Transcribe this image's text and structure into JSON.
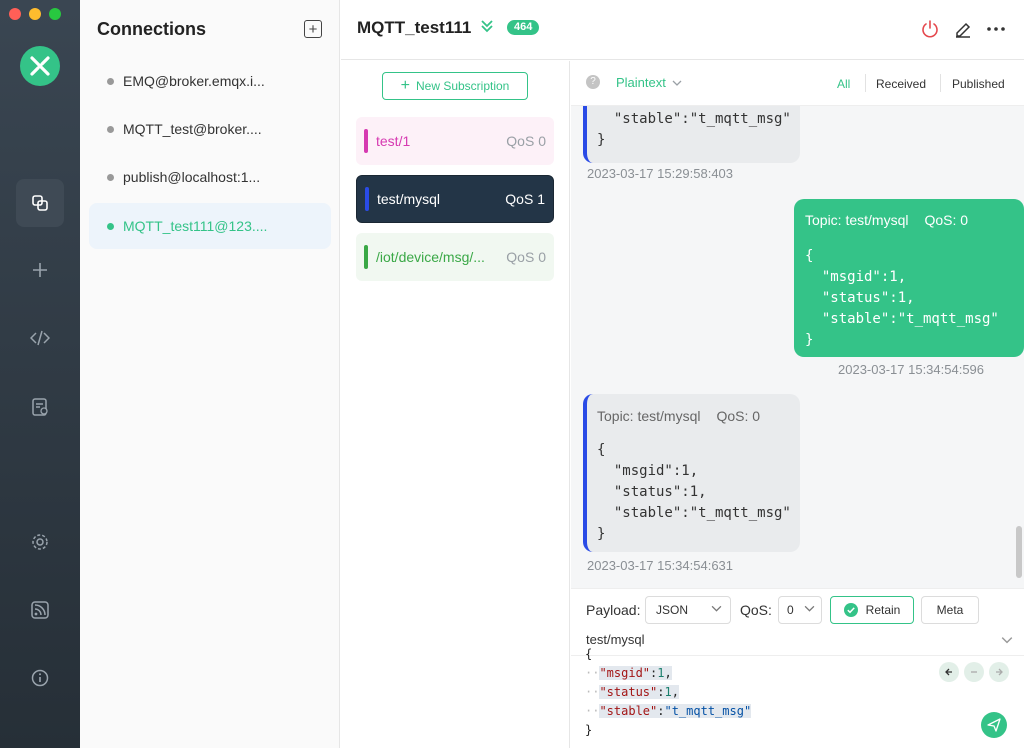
{
  "window": {
    "traffic_colors": [
      "#ff5f57",
      "#febc2e",
      "#28c840"
    ]
  },
  "rail": {
    "items": [
      {
        "name": "connections-icon",
        "active": true
      },
      {
        "name": "plus-icon"
      },
      {
        "name": "code-icon"
      },
      {
        "name": "log-icon"
      },
      {
        "name": "settings-icon"
      },
      {
        "name": "rss-icon"
      },
      {
        "name": "info-icon"
      }
    ]
  },
  "connections": {
    "title": "Connections",
    "items": [
      {
        "label": "EMQ@broker.emqx.i..."
      },
      {
        "label": "MQTT_test@broker...."
      },
      {
        "label": "publish@localhost:1..."
      },
      {
        "label": "MQTT_test111@123....",
        "active": true
      }
    ]
  },
  "header": {
    "title": "MQTT_test111",
    "badge": "464"
  },
  "subscriptions": {
    "new_label": "New Subscription",
    "items": [
      {
        "topic": "test/1",
        "qos": "QoS 0",
        "color": "#d63ab1",
        "bg": "#fdf1f8"
      },
      {
        "topic": "test/mysql",
        "qos": "QoS 1",
        "color": "#2a4be6",
        "bg": "#233547",
        "active": true
      },
      {
        "topic": "/iot/device/msg/...",
        "qos": "QoS 0",
        "color": "#3aa846",
        "bg": "#f1f8f1"
      }
    ]
  },
  "message_bar": {
    "format": "Plaintext",
    "filters": [
      "All",
      "Received",
      "Published"
    ]
  },
  "messages": [
    {
      "type": "received",
      "payload_tail": "  \"stable\":\"t_mqtt_msg\"\n}",
      "time": "2023-03-17 15:29:58:403"
    },
    {
      "type": "sent",
      "topic": "Topic: test/mysql",
      "qos": "QoS: 0",
      "payload": "{\n  \"msgid\":1,\n  \"status\":1,\n  \"stable\":\"t_mqtt_msg\"\n}",
      "time": "2023-03-17 15:34:54:596"
    },
    {
      "type": "received",
      "topic": "Topic: test/mysql",
      "qos": "QoS: 0",
      "payload": "{\n  \"msgid\":1,\n  \"status\":1,\n  \"stable\":\"t_mqtt_msg\"\n}",
      "time": "2023-03-17 15:34:54:631"
    }
  ],
  "composer": {
    "payload_label": "Payload:",
    "payload_format": "JSON",
    "qos_label": "QoS:",
    "qos_value": "0",
    "retain_label": "Retain",
    "meta_label": "Meta",
    "topic": "test/mysql",
    "code": {
      "open": "{",
      "lines": [
        {
          "key": "\"msgid\"",
          "val": "1",
          "val_type": "num"
        },
        {
          "key": "\"status\"",
          "val": "1",
          "val_type": "num"
        },
        {
          "key": "\"stable\"",
          "val": "\"t_mqtt_msg\"",
          "val_type": "str"
        }
      ],
      "close": "}"
    }
  },
  "colors": {
    "accent": "#34c388",
    "rail_dark": "#262f37"
  }
}
